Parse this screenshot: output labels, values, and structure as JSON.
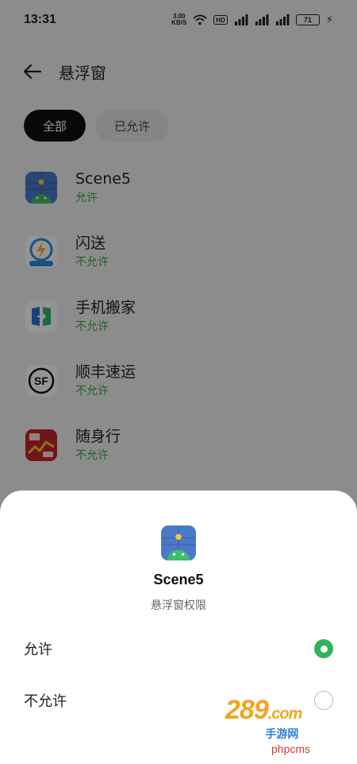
{
  "status_bar": {
    "time": "13:31",
    "net_speed_value": "3.00",
    "net_speed_unit": "KB/S",
    "hd_label": "HD",
    "battery_level": "71"
  },
  "header": {
    "title": "悬浮窗"
  },
  "filters": [
    {
      "label": "全部",
      "active": true
    },
    {
      "label": "已允许",
      "active": false
    }
  ],
  "apps": [
    {
      "name": "Scene5",
      "status": "允许",
      "icon": "scene5-icon"
    },
    {
      "name": "闪送",
      "status": "不允许",
      "icon": "shansong-icon"
    },
    {
      "name": "手机搬家",
      "status": "不允许",
      "icon": "phone-clone-icon"
    },
    {
      "name": "顺丰速运",
      "status": "不允许",
      "icon": "sf-express-icon"
    },
    {
      "name": "随身行",
      "status": "不允许",
      "icon": "suishenxing-icon"
    }
  ],
  "sheet": {
    "app_name": "Scene5",
    "subtitle": "悬浮窗权限",
    "options": [
      {
        "label": "允许",
        "selected": true
      },
      {
        "label": "不允许",
        "selected": false
      }
    ]
  },
  "watermark": {
    "logo_main": "289",
    "logo_suffix": ".com",
    "logo_sub": "手游网",
    "text": "phpcms"
  },
  "colors": {
    "accent_green": "#2fb45a",
    "status_green": "#3da647",
    "chip_active": "#111111"
  }
}
